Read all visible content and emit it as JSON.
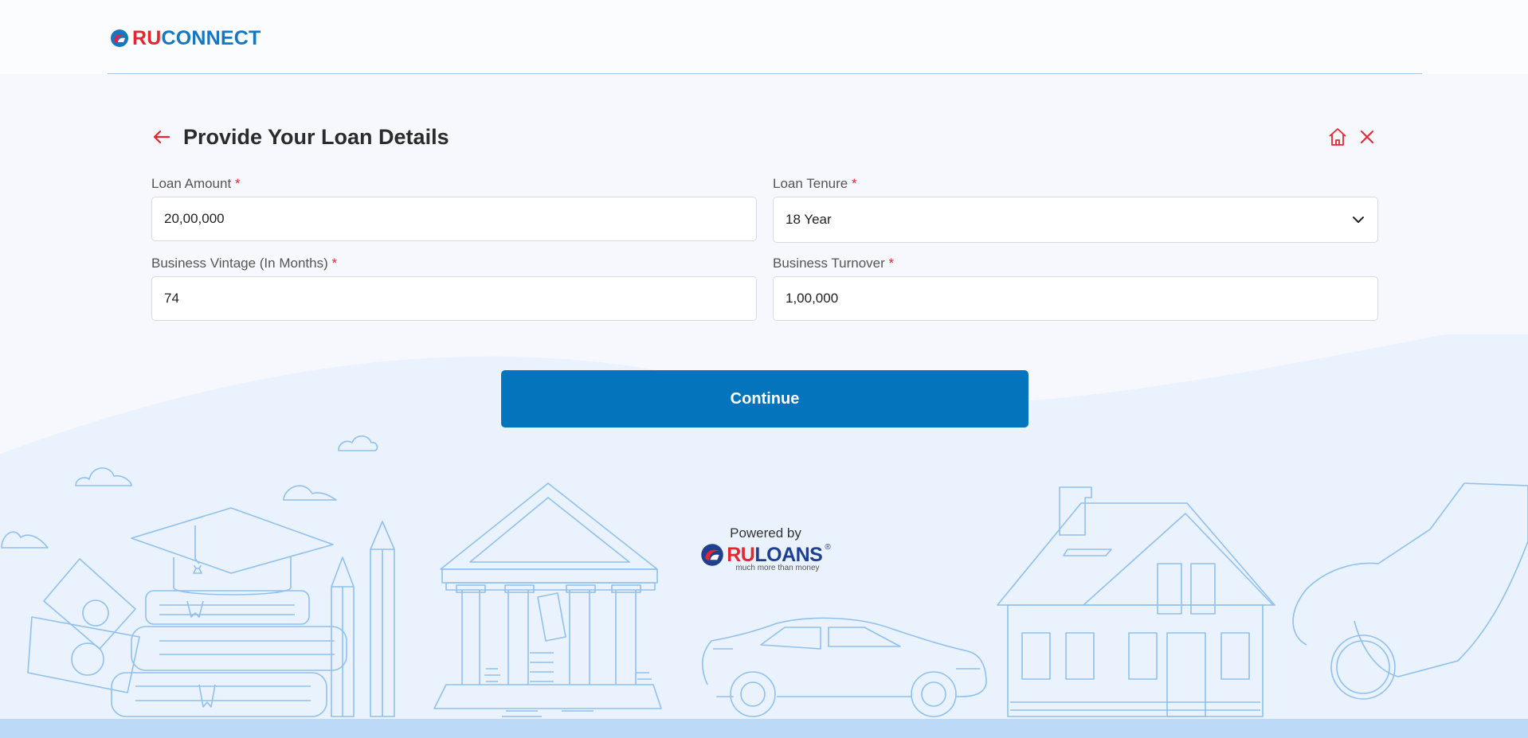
{
  "brand": {
    "logo_ru": "RU",
    "logo_connect": "CONNECT"
  },
  "header": {
    "title": "Provide Your Loan Details"
  },
  "form": {
    "loan_amount": {
      "label": "Loan Amount",
      "required": "*",
      "value": "20,00,000"
    },
    "loan_tenure": {
      "label": "Loan Tenure",
      "required": "*",
      "value": "18 Year"
    },
    "business_vintage": {
      "label": "Business Vintage (In Months)",
      "required": "*",
      "value": "74"
    },
    "business_turnover": {
      "label": "Business Turnover",
      "required": "*",
      "value": "1,00,000"
    }
  },
  "actions": {
    "continue_label": "Continue"
  },
  "footer": {
    "powered_by": "Powered by",
    "ruloans_ru": "RU",
    "ruloans_loans": "LOANS",
    "registered": "®",
    "tagline": "much more than money"
  },
  "colors": {
    "accent_red": "#e3262f",
    "primary_blue": "#0474bc",
    "line_art": "#8fc0ee"
  },
  "icons": [
    "back-arrow-icon",
    "home-icon",
    "close-icon",
    "chevron-down-icon"
  ]
}
